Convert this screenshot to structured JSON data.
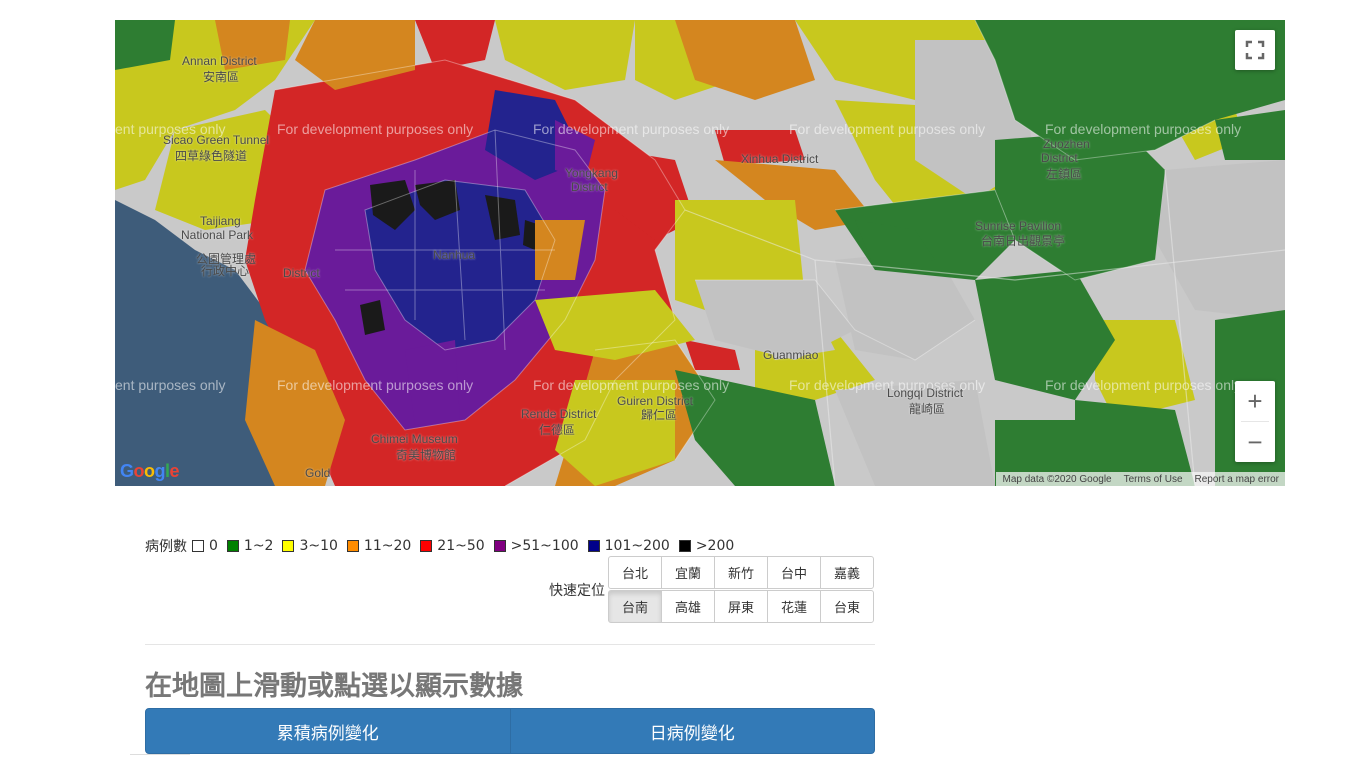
{
  "map": {
    "watermark": "For development purposes only",
    "watermark_partial": "ent purposes only",
    "places": [
      {
        "name": "Annan District"
      },
      {
        "name": "安南區"
      },
      {
        "name": "Sicao Green Tunnel"
      },
      {
        "name": "四草綠色隧道"
      },
      {
        "name": "Taijiang"
      },
      {
        "name": "National Park"
      },
      {
        "name": "公園管理處"
      },
      {
        "name": "行政中心"
      },
      {
        "name": "District"
      },
      {
        "name": "Yongkang"
      },
      {
        "name": "District"
      },
      {
        "name": "Xinhua District"
      },
      {
        "name": "Zuozhen"
      },
      {
        "name": "District"
      },
      {
        "name": "左鎮區"
      },
      {
        "name": "Sunrise Pavilion"
      },
      {
        "name": "台南日出觀景亭"
      },
      {
        "name": "Guanmiao"
      },
      {
        "name": "Rende District"
      },
      {
        "name": "仁德區"
      },
      {
        "name": "Guiren District"
      },
      {
        "name": "歸仁區"
      },
      {
        "name": "Chimei Museum"
      },
      {
        "name": "奇美博物館"
      },
      {
        "name": "Longqi District"
      },
      {
        "name": "龍崎區"
      },
      {
        "name": "Nanhua"
      },
      {
        "name": "Gold"
      }
    ],
    "attribution": {
      "data": "Map data ©2020 Google",
      "terms": "Terms of Use",
      "report": "Report a map error"
    },
    "zoom_in": "+",
    "zoom_out": "−",
    "logo": "Google"
  },
  "legend": {
    "title": "病例數",
    "items": [
      {
        "label": "0",
        "color": "#ffffff"
      },
      {
        "label": "1~2",
        "color": "#008000"
      },
      {
        "label": "3~10",
        "color": "#ffff00"
      },
      {
        "label": "11~20",
        "color": "#ff8c00"
      },
      {
        "label": "21~50",
        "color": "#ff0000"
      },
      {
        "label": ">51~100",
        "color": "#800080"
      },
      {
        "label": "101~200",
        "color": "#00008b"
      },
      {
        "label": ">200",
        "color": "#000000"
      }
    ]
  },
  "quick_locate": {
    "label": "快速定位",
    "row1": [
      "台北",
      "宜蘭",
      "新竹",
      "台中",
      "嘉義"
    ],
    "row2": [
      "台南",
      "高雄",
      "屏東",
      "花蓮",
      "台東"
    ],
    "active": "台南"
  },
  "heading": "在地圖上滑動或點選以顯示數據",
  "tabs": [
    "累積病例變化",
    "日病例變化"
  ]
}
